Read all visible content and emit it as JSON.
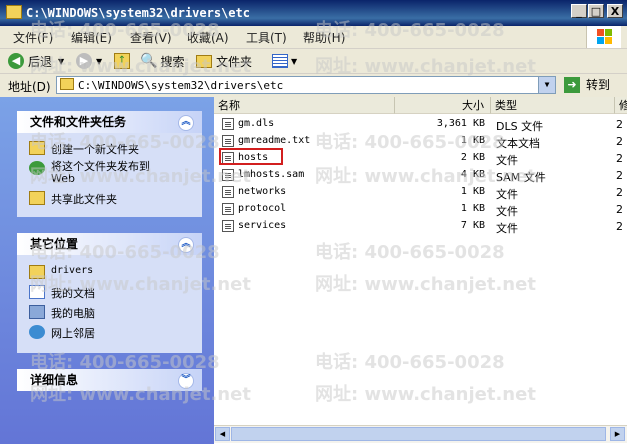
{
  "window": {
    "title": "C:\\WINDOWS\\system32\\drivers\\etc",
    "controls": [
      "_",
      "□",
      "X"
    ]
  },
  "menu": [
    "文件(F)",
    "编辑(E)",
    "查看(V)",
    "收藏(A)",
    "工具(T)",
    "帮助(H)"
  ],
  "toolbar": {
    "back": "后退",
    "search": "搜索",
    "folders": "文件夹"
  },
  "address": {
    "label": "地址(D)",
    "value": "C:\\WINDOWS\\system32\\drivers\\etc",
    "go": "转到"
  },
  "tasks_panel": {
    "title": "文件和文件夹任务",
    "links": [
      "创建一个新文件夹",
      "将这个文件夹发布到",
      "Web",
      "共享此文件夹"
    ]
  },
  "places_panel": {
    "title": "其它位置",
    "links": [
      "drivers",
      "我的文档",
      "我的电脑",
      "网上邻居"
    ]
  },
  "details_panel": {
    "title": "详细信息"
  },
  "columns": {
    "name": "名称",
    "size": "大小",
    "type": "类型",
    "extra": "修"
  },
  "files": [
    {
      "name": "gm.dls",
      "size": "3,361 KB",
      "type": "DLS 文件",
      "extra": "2"
    },
    {
      "name": "gmreadme.txt",
      "size": "1 KB",
      "type": "文本文档",
      "extra": "2"
    },
    {
      "name": "hosts",
      "size": "2 KB",
      "type": "文件",
      "extra": "2"
    },
    {
      "name": "lmhosts.sam",
      "size": "4 KB",
      "type": "SAM 文件",
      "extra": "2"
    },
    {
      "name": "networks",
      "size": "1 KB",
      "type": "文件",
      "extra": "2"
    },
    {
      "name": "protocol",
      "size": "1 KB",
      "type": "文件",
      "extra": "2"
    },
    {
      "name": "services",
      "size": "7 KB",
      "type": "文件",
      "extra": "2"
    }
  ],
  "watermark": {
    "phone": "电话: 400-665-0028",
    "site": "网址: www.chanjet.net"
  }
}
